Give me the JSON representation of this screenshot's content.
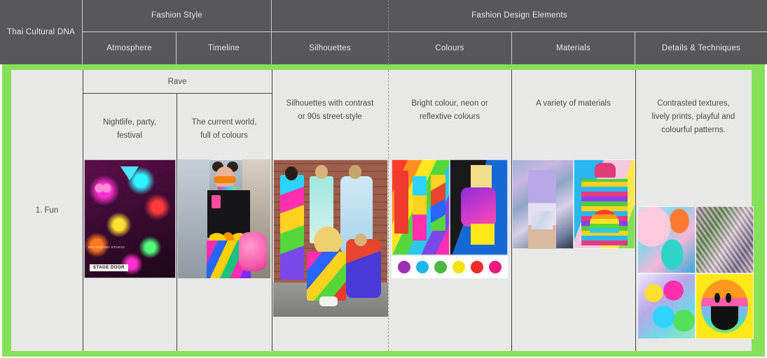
{
  "table": {
    "corner_label": "Thai Cultural DNA",
    "group_headers": [
      {
        "label": "Fashion Style",
        "span": 2
      },
      {
        "label": "Fashion Design Elements",
        "span": 4
      }
    ],
    "columns": [
      {
        "key": "atmosphere",
        "label": "Atmosphere"
      },
      {
        "key": "timeline",
        "label": "Timeline"
      },
      {
        "key": "silhouettes",
        "label": "Silhouettes"
      },
      {
        "key": "colours",
        "label": "Colours"
      },
      {
        "key": "materials",
        "label": "Materials"
      },
      {
        "key": "details",
        "label": "Details & Techniques"
      }
    ],
    "rows": [
      {
        "row_label": "1. Fun",
        "merged_top_cell": "Rave",
        "cells": {
          "atmosphere": "Nightlife, party,\nfestival",
          "timeline": "The current world,\nfull of colours",
          "silhouettes": "Silhouettes with contrast\nor 90s street-style",
          "colours": "Bright colour, neon or\nreflextive colours",
          "materials": "A variety of materials",
          "details": "Contrasted textures,\nlively prints, playful and\ncolourful patterns."
        }
      }
    ]
  },
  "colour_swatches": [
    {
      "name": "purple",
      "hex": "#9b2fb0"
    },
    {
      "name": "cyan",
      "hex": "#21b6e8"
    },
    {
      "name": "green",
      "hex": "#4ab843"
    },
    {
      "name": "yellow",
      "hex": "#f2e310"
    },
    {
      "name": "red",
      "hex": "#ee2b2b"
    },
    {
      "name": "magenta",
      "hex": "#ec1a7e"
    }
  ],
  "images": {
    "atmosphere_left": {
      "name": "neon-arcade-photo",
      "caption_sign": "STAGE DOOR",
      "caption_small": "RECORDING STUDIO"
    },
    "atmosphere_right": {
      "name": "street-style-neon-outfit-photo"
    },
    "silhouettes": {
      "name": "group-of-five-rave-outfits-brick-wall-photo"
    },
    "colours_left": {
      "name": "three-women-rainbow-wall-photo"
    },
    "colours_right": {
      "name": "purple-fur-jacket-yellow-shorts-photo"
    },
    "materials_left": {
      "name": "holographic-iridescent-outfit-photo"
    },
    "materials_right": {
      "name": "rainbow-knit-sweater-backpack-photo"
    },
    "details_tl": {
      "name": "pastel-fabric-texture-swatch"
    },
    "details_tr": {
      "name": "crumpled-iridescent-texture-swatch"
    },
    "details_bl": {
      "name": "tie-dye-print-swatch"
    },
    "details_br": {
      "name": "gradient-smiley-face-graphic"
    }
  },
  "colors": {
    "header_bg": "#58585a",
    "header_text": "#e9e9ea",
    "cell_bg": "#e8e8e6",
    "cell_text": "#4a4a4a",
    "row_highlight": "#86e05a",
    "grid_line": "#3f3f3f",
    "header_grid_line": "#cfcfcf",
    "dashed_divider": "#9a9a9a"
  }
}
